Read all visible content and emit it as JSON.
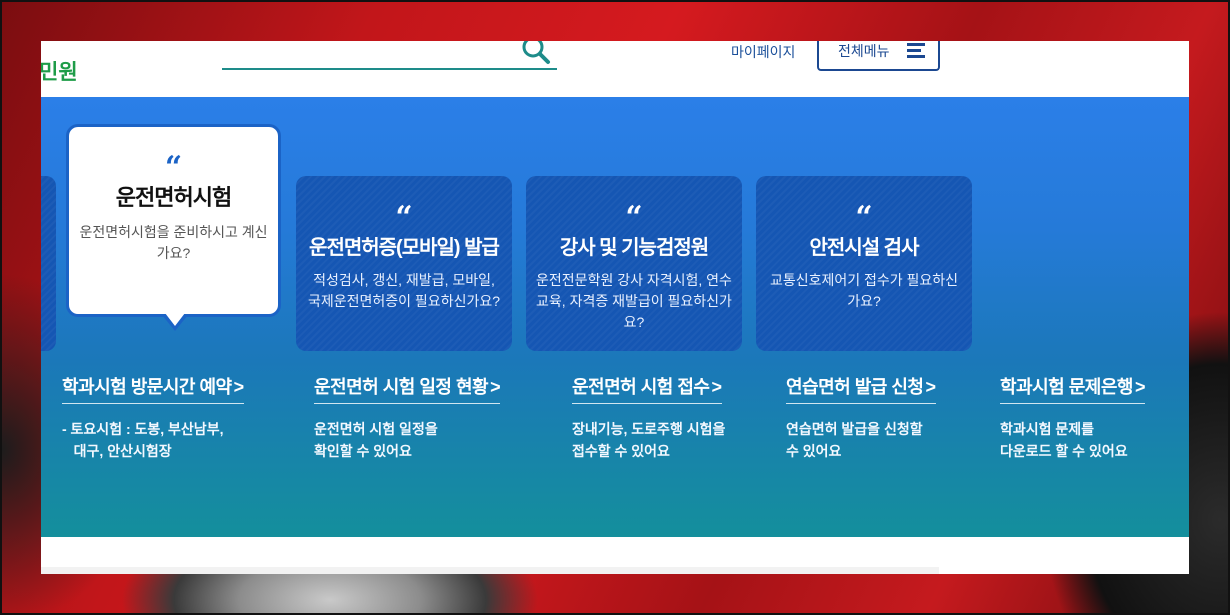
{
  "header": {
    "brand": "민원",
    "search_placeholder": "",
    "mypage": "마이페이지",
    "all_menu": "전체메뉴"
  },
  "cards": [
    {
      "title": "운전면허시험",
      "desc": "운전면허시험을 준비하시고 계신가요?",
      "active": true
    },
    {
      "title": "운전면허증(모바일) 발급",
      "desc": "적성검사, 갱신, 재발급, 모바일, 국제운전면허증이 필요하신가요?"
    },
    {
      "title": "강사 및 기능검정원",
      "desc": "운전전문학원 강사 자격시험, 연수교육, 자격증 재발급이 필요하신가요?"
    },
    {
      "title": "안전시설 검사",
      "desc": "교통신호제어기 접수가 필요하신가요?"
    }
  ],
  "quote_mark": "“",
  "links": [
    {
      "title": "학과시험 방문시간 예약",
      "desc_lines": [
        "- 토요시험 : 도봉, 부산남부,",
        "   대구, 안산시험장"
      ]
    },
    {
      "title": "운전면허 시험 일정 현황",
      "desc_lines": [
        "운전면허 시험 일정을",
        "확인할 수 있어요"
      ]
    },
    {
      "title": "운전면허 시험 접수",
      "desc_lines": [
        "장내기능, 도로주행 시험을",
        "접수할 수 있어요"
      ]
    },
    {
      "title": "연습면허 발급 신청",
      "desc_lines": [
        "연습면허 발급을 신청할",
        "수 있어요"
      ]
    },
    {
      "title": "학과시험 문제은행",
      "desc_lines": [
        "학과시험 문제를",
        "다운로드 할 수 있어요"
      ]
    }
  ],
  "chevron": ">",
  "colors": {
    "brand_green": "#1e9c48",
    "navy": "#1b4891",
    "card_blue": "#1556b3",
    "hero_top": "#2b7fe8",
    "hero_bottom": "#148f9c"
  }
}
